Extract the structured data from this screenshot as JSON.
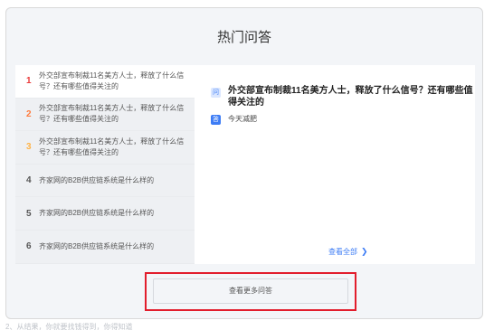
{
  "title": "热门问答",
  "questions": [
    {
      "rank": "1",
      "text": "外交部宣布制裁11名美方人士，释放了什么信号？还有哪些值得关注的",
      "rank_color": "#ea3a3a",
      "active": true
    },
    {
      "rank": "2",
      "text": "外交部宣布制裁11名美方人士，释放了什么信号？还有哪些值得关注的",
      "rank_color": "#ff7a3a",
      "active": false
    },
    {
      "rank": "3",
      "text": "外交部宣布制裁11名美方人士，释放了什么信号？还有哪些值得关注的",
      "rank_color": "#ffb347",
      "active": false
    },
    {
      "rank": "4",
      "text": "齐家网的B2B供应链系统是什么样的",
      "rank_color": "#555555",
      "active": false
    },
    {
      "rank": "5",
      "text": "齐家网的B2B供应链系统是什么样的",
      "rank_color": "#555555",
      "active": false
    },
    {
      "rank": "6",
      "text": "齐家网的B2B供应链系统是什么样的",
      "rank_color": "#555555",
      "active": false
    }
  ],
  "detail": {
    "q_badge": "问",
    "question": "外交部宣布制裁11名美方人士，释放了什么信号？还有哪些值得关注的",
    "a_badge": "答",
    "answer": "今天减肥",
    "see_all": "查看全部",
    "see_all_icon": "chevron-right-icon"
  },
  "more_button": "查看更多问答",
  "footer_text": "2、从结果，你就要找钱得到，你得知道"
}
